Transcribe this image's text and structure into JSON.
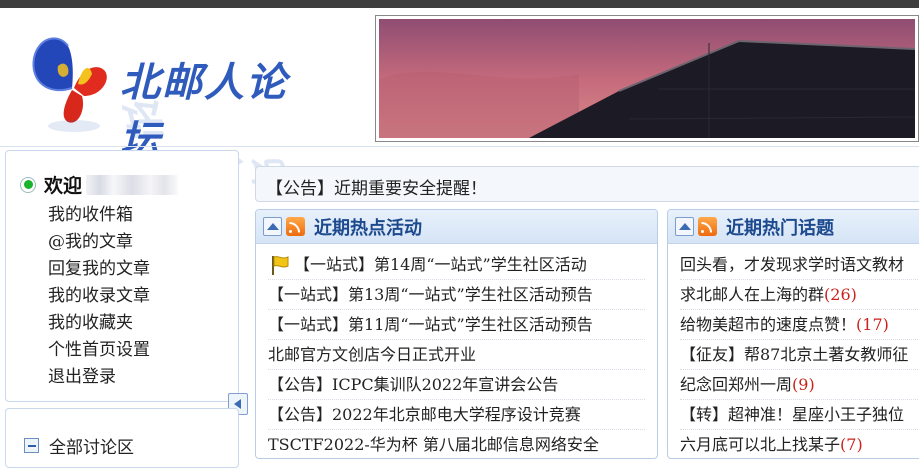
{
  "logo": {
    "text": "北邮人论坛"
  },
  "sidebar": {
    "welcome": "欢迎",
    "menu": [
      "我的收件箱",
      "@我的文章",
      "回复我的文章",
      "我的收录文章",
      "我的收藏夹",
      "个性首页设置",
      "退出登录"
    ]
  },
  "sidebar2": {
    "title": "全部讨论区"
  },
  "notice": {
    "text": "【公告】近期重要安全提醒！"
  },
  "panels": {
    "activities": {
      "title": "近期热点活动",
      "items": [
        "【一站式】第14周“一站式”学生社区活动",
        "【一站式】第13周“一站式”学生社区活动预告",
        "【一站式】第11周“一站式”学生社区活动预告",
        "北邮官方文创店今日正式开业",
        "【公告】ICPC集训队2022年宣讲会公告",
        "【公告】2022年北京邮电大学程序设计竞赛",
        "TSCTF2022-华为杯 第八届北邮信息网络安全"
      ]
    },
    "topics": {
      "title": "近期热门话题",
      "items": [
        {
          "text": "回头看，才发现求学时语文教材",
          "count": ""
        },
        {
          "text": "求北邮人在上海的群",
          "count": "(26)"
        },
        {
          "text": "给物美超市的速度点赞！",
          "count": "(17)"
        },
        {
          "text": "【征友】帮87北京土著女教师征",
          "count": ""
        },
        {
          "text": "纪念回郑州一周",
          "count": "(9)"
        },
        {
          "text": "【转】超神准！星座小王子独位",
          "count": ""
        },
        {
          "text": "六月底可以北上找某子",
          "count": "(7)"
        }
      ]
    }
  },
  "colors": {
    "accent": "#1d4a8e",
    "count_red": "#c8231d",
    "online_green": "#19b32c"
  }
}
